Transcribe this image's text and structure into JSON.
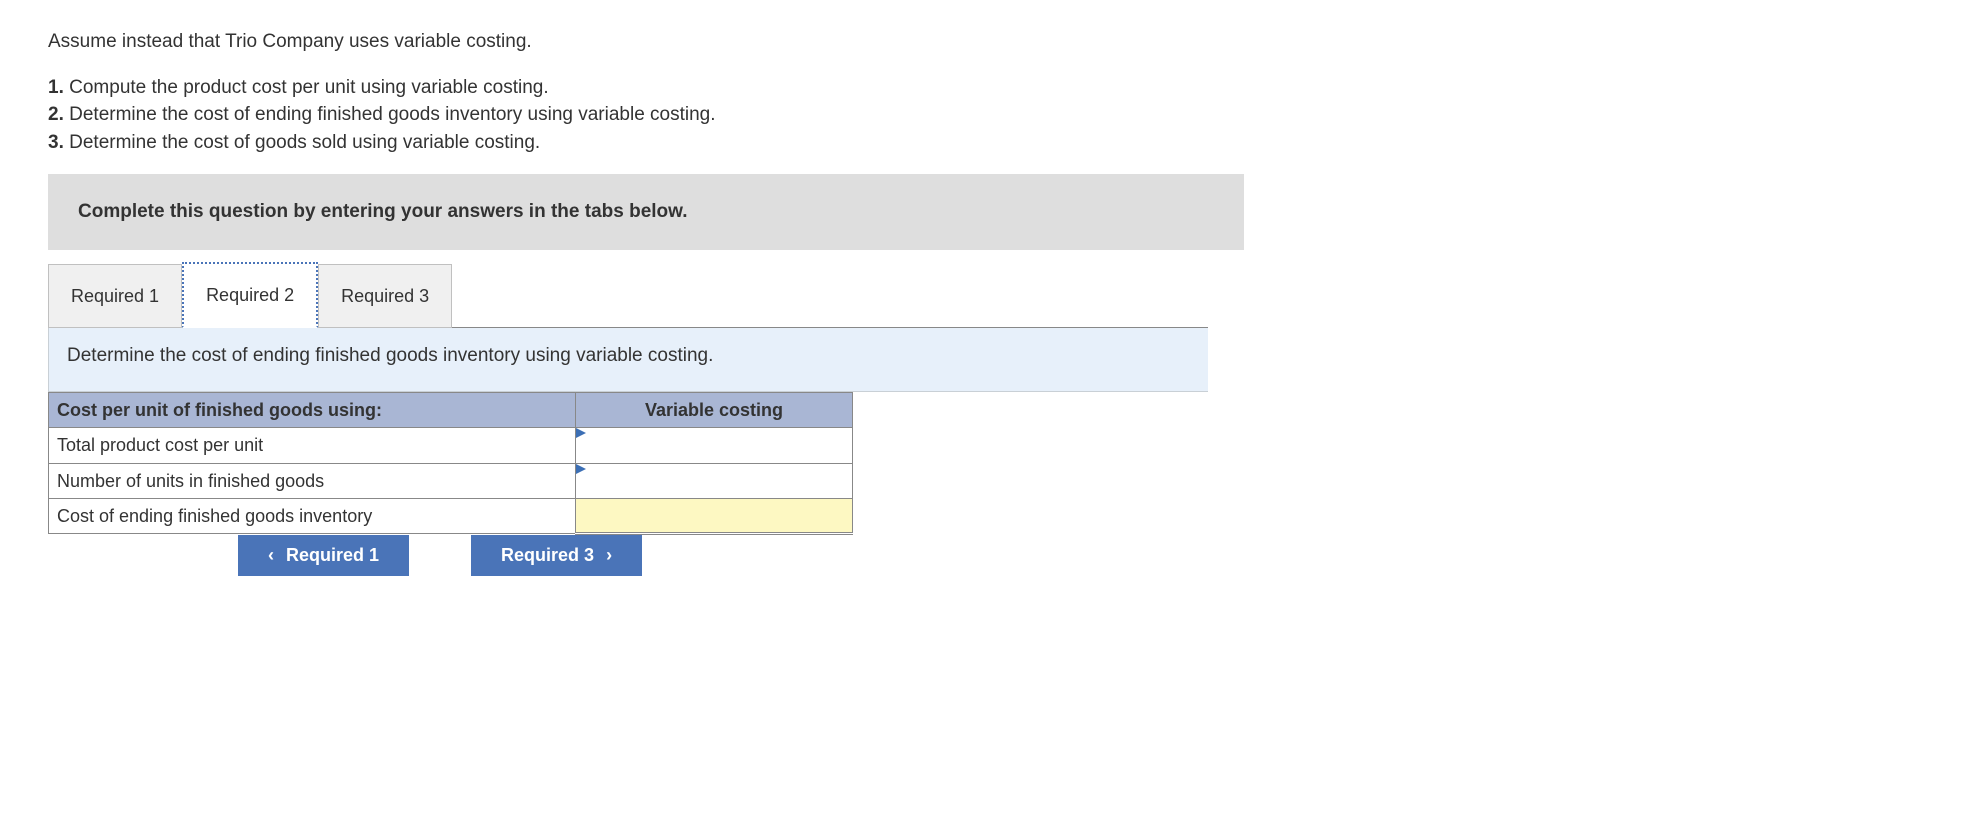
{
  "intro": "Assume instead that Trio Company uses variable costing.",
  "questions": [
    {
      "num": "1.",
      "text": "Compute the product cost per unit using variable costing."
    },
    {
      "num": "2.",
      "text": "Determine the cost of ending finished goods inventory using variable costing."
    },
    {
      "num": "3.",
      "text": "Determine the cost of goods sold using variable costing."
    }
  ],
  "instruction": "Complete this question by entering your answers in the tabs below.",
  "tabs": [
    {
      "label": "Required 1",
      "active": false
    },
    {
      "label": "Required 2",
      "active": true
    },
    {
      "label": "Required 3",
      "active": false
    }
  ],
  "tab_prompt": "Determine the cost of ending finished goods inventory using variable costing.",
  "table": {
    "header_left": "Cost per unit of finished goods using:",
    "header_right": "Variable costing",
    "rows": [
      {
        "label": "Total product cost per unit",
        "value": "",
        "type": "input"
      },
      {
        "label": "Number of units in finished goods",
        "value": "",
        "type": "input"
      },
      {
        "label": "Cost of ending finished goods inventory",
        "value": "",
        "type": "calc"
      }
    ]
  },
  "nav": {
    "prev": "Required 1",
    "next": "Required 3"
  }
}
